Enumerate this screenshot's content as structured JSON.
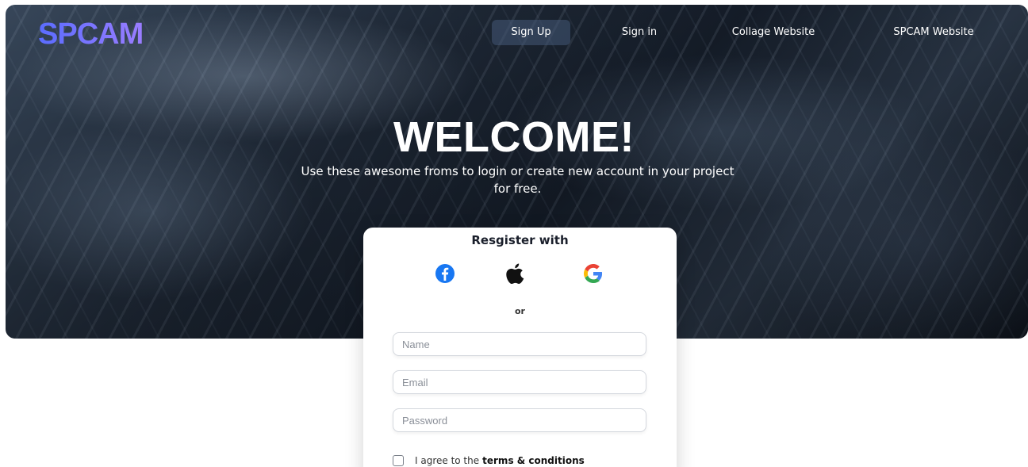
{
  "brand": {
    "logo_text": "SPCAM"
  },
  "nav": {
    "items": [
      {
        "label": "Sign Up",
        "active": true
      },
      {
        "label": "Sign in",
        "active": false
      },
      {
        "label": "Collage Website",
        "active": false
      },
      {
        "label": "SPCAM Website",
        "active": false
      }
    ]
  },
  "hero": {
    "title": "WELCOME!",
    "subtitle": "Use these awesome froms to login or create new account in your project for free."
  },
  "register_card": {
    "title": "Resgister with",
    "social": [
      {
        "icon": "facebook-icon",
        "color": "#1877f2"
      },
      {
        "icon": "apple-icon",
        "color": "#111111"
      },
      {
        "icon": "google-icon",
        "color": "#4285f4"
      }
    ],
    "divider_text": "or",
    "fields": {
      "name_placeholder": "Name",
      "email_placeholder": "Email",
      "password_placeholder": "Password"
    },
    "agree": {
      "prefix": "I agree to the",
      "link": "terms & conditions",
      "checked": false
    }
  },
  "colors": {
    "logo_gradient_start": "#5a6cff",
    "logo_gradient_end": "#9a7dff",
    "active_nav_bg": "#465a78"
  }
}
